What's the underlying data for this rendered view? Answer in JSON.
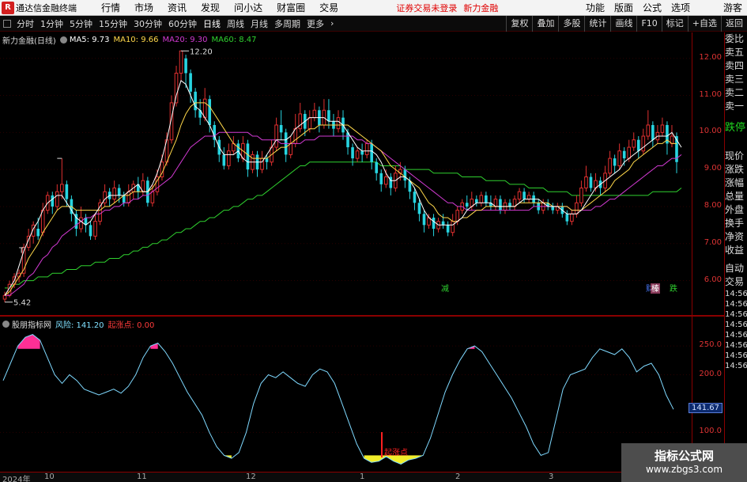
{
  "app": {
    "logo": "R",
    "title": "通达信金融终端"
  },
  "menu": [
    "行情",
    "市场",
    "资讯",
    "发现",
    "问小达",
    "财富圈",
    "交易"
  ],
  "menu_status": {
    "trade_login": "证券交易未登录",
    "broker": "新力金融"
  },
  "menu_right": [
    "功能",
    "版面",
    "公式",
    "选项",
    "游客"
  ],
  "toolbar": {
    "periods": [
      "分时",
      "1分钟",
      "5分钟",
      "15分钟",
      "30分钟",
      "60分钟",
      "日线",
      "周线",
      "月线",
      "多周期",
      "更多"
    ],
    "active_period": "日线",
    "right_buttons": [
      "复权",
      "叠加",
      "多股",
      "统计",
      "画线",
      "F10",
      "标记",
      "+自选",
      "返回"
    ]
  },
  "main_legend": {
    "stock": "新力金融(日线)",
    "ma5": "MA5: 9.73",
    "ma10": "MA10: 9.66",
    "ma20": "MA20: 9.30",
    "ma60": "MA60: 8.47",
    "colors": {
      "ma5": "#ffffff",
      "ma10": "#ffd84a",
      "ma20": "#d23ad2",
      "ma60": "#2fd12f",
      "up": "#e03030",
      "down": "#27d4e0"
    }
  },
  "price_axis": [
    "12.00",
    "11.00",
    "10.00",
    "9.00",
    "8.00",
    "7.00",
    "6.00"
  ],
  "annotations": {
    "high": "12.20",
    "low": "5.42",
    "t_marker": "T",
    "jian": "减",
    "cha": "财",
    "rong": "榛",
    "die": "跌"
  },
  "indicator_legend": {
    "name": "股朋指标网",
    "risk": "风险: 141.20",
    "start": "起涨点: 0.00",
    "start_marker": "起涨点"
  },
  "indicator_axis": [
    "250.0",
    "200.0",
    "141.67",
    "100.0"
  ],
  "dates": [
    "2024年",
    "10",
    "11",
    "12",
    "1",
    "2",
    "3"
  ],
  "right_panel": {
    "items_top": [
      "委比",
      "卖五",
      "卖四",
      "卖三",
      "卖二",
      "卖一"
    ],
    "status": "跌停",
    "items_mid": [
      "现价",
      "涨跌",
      "涨幅",
      "总量",
      "外盘",
      "换手",
      "净资",
      "收益"
    ],
    "items_bottom": [
      "自动",
      "交易"
    ],
    "times": [
      "14:56",
      "14:56",
      "14:56",
      "14:56",
      "14:56",
      "14:56",
      "14:56",
      "14:56"
    ]
  },
  "watermark": {
    "title": "指标公式网",
    "url": "www.zbgs3.com"
  },
  "chart_data": {
    "type": "candlestick",
    "ylim": [
      5.2,
      12.4
    ],
    "candles": [
      [
        5.5,
        5.6,
        5.42,
        5.7
      ],
      [
        5.6,
        5.9,
        5.55,
        6.0
      ],
      [
        5.9,
        6.1,
        5.8,
        6.2
      ],
      [
        6.1,
        6.2,
        5.95,
        6.3
      ],
      [
        6.2,
        6.9,
        6.1,
        7.0
      ],
      [
        6.9,
        7.2,
        6.8,
        7.4
      ],
      [
        7.2,
        7.5,
        7.0,
        7.6
      ],
      [
        7.4,
        7.2,
        7.1,
        7.7
      ],
      [
        7.3,
        7.9,
        7.2,
        8.1
      ],
      [
        7.9,
        8.3,
        7.8,
        8.4
      ],
      [
        8.3,
        8.0,
        7.8,
        8.4
      ],
      [
        8.0,
        8.4,
        7.9,
        8.6
      ],
      [
        8.4,
        8.6,
        8.2,
        9.3
      ],
      [
        8.6,
        8.2,
        8.0,
        8.7
      ],
      [
        8.2,
        7.8,
        7.6,
        8.3
      ],
      [
        7.8,
        7.4,
        7.2,
        7.9
      ],
      [
        7.4,
        7.7,
        7.3,
        8.0
      ],
      [
        7.7,
        7.5,
        7.3,
        7.8
      ],
      [
        7.5,
        7.2,
        7.1,
        7.6
      ],
      [
        7.2,
        7.6,
        7.1,
        7.8
      ],
      [
        7.6,
        8.1,
        7.5,
        8.2
      ],
      [
        8.1,
        8.4,
        8.0,
        8.6
      ],
      [
        8.4,
        8.2,
        8.0,
        8.5
      ],
      [
        8.2,
        8.5,
        8.1,
        8.7
      ],
      [
        8.5,
        8.3,
        8.1,
        8.6
      ],
      [
        8.3,
        8.1,
        8.0,
        8.4
      ],
      [
        8.1,
        8.4,
        8.0,
        8.6
      ],
      [
        8.4,
        8.6,
        8.2,
        8.7
      ],
      [
        8.6,
        8.4,
        8.2,
        8.8
      ],
      [
        8.4,
        8.7,
        8.3,
        8.9
      ],
      [
        8.7,
        8.1,
        8.0,
        8.8
      ],
      [
        8.1,
        8.4,
        8.0,
        8.6
      ],
      [
        8.4,
        8.8,
        8.3,
        9.0
      ],
      [
        8.8,
        9.2,
        8.7,
        9.4
      ],
      [
        9.2,
        9.8,
        9.1,
        10.0
      ],
      [
        9.8,
        10.8,
        9.7,
        11.0
      ],
      [
        10.8,
        11.6,
        10.7,
        11.8
      ],
      [
        11.6,
        12.2,
        11.4,
        12.2
      ],
      [
        12.0,
        11.6,
        11.2,
        12.1
      ],
      [
        11.6,
        11.1,
        10.8,
        11.7
      ],
      [
        11.1,
        10.6,
        10.4,
        11.2
      ],
      [
        10.6,
        10.4,
        10.2,
        10.9
      ],
      [
        10.4,
        10.9,
        10.3,
        11.2
      ],
      [
        10.9,
        10.2,
        10.0,
        11.0
      ],
      [
        10.2,
        9.8,
        9.6,
        10.3
      ],
      [
        9.8,
        9.4,
        9.2,
        9.9
      ],
      [
        9.4,
        9.1,
        9.0,
        9.6
      ],
      [
        9.1,
        9.5,
        9.0,
        9.7
      ],
      [
        9.5,
        9.7,
        9.4,
        9.9
      ],
      [
        9.7,
        9.3,
        9.2,
        9.8
      ],
      [
        9.3,
        9.7,
        9.2,
        9.9
      ],
      [
        9.7,
        9.0,
        8.8,
        9.8
      ],
      [
        9.0,
        9.4,
        8.9,
        9.5
      ],
      [
        9.4,
        9.0,
        8.8,
        9.5
      ],
      [
        9.0,
        9.3,
        8.9,
        9.5
      ],
      [
        9.3,
        9.2,
        9.0,
        9.4
      ],
      [
        9.2,
        9.6,
        9.1,
        9.8
      ],
      [
        9.6,
        10.2,
        9.5,
        10.4
      ],
      [
        10.2,
        10.0,
        9.8,
        10.6
      ],
      [
        10.0,
        9.4,
        9.2,
        10.1
      ],
      [
        9.4,
        9.7,
        9.3,
        9.9
      ],
      [
        9.7,
        10.1,
        9.6,
        10.5
      ],
      [
        10.1,
        10.5,
        10.0,
        10.8
      ],
      [
        10.5,
        10.1,
        9.9,
        10.6
      ],
      [
        10.1,
        10.4,
        10.0,
        10.6
      ],
      [
        10.4,
        10.6,
        10.3,
        10.8
      ],
      [
        10.6,
        10.2,
        10.0,
        10.7
      ],
      [
        10.2,
        10.6,
        10.1,
        10.9
      ],
      [
        10.6,
        10.3,
        10.1,
        10.9
      ],
      [
        10.3,
        10.1,
        9.9,
        10.5
      ],
      [
        10.1,
        10.4,
        10.0,
        10.6
      ],
      [
        10.4,
        10.0,
        9.8,
        10.6
      ],
      [
        10.0,
        9.6,
        9.4,
        10.1
      ],
      [
        9.6,
        9.3,
        9.1,
        9.7
      ],
      [
        9.3,
        9.5,
        9.2,
        9.6
      ],
      [
        9.5,
        9.4,
        9.2,
        9.7
      ],
      [
        9.4,
        9.7,
        9.3,
        9.8
      ],
      [
        9.7,
        9.2,
        9.0,
        9.8
      ],
      [
        9.2,
        8.9,
        8.7,
        9.3
      ],
      [
        8.9,
        8.6,
        8.4,
        9.0
      ],
      [
        8.6,
        8.8,
        8.5,
        9.0
      ],
      [
        8.8,
        8.5,
        8.3,
        8.9
      ],
      [
        8.5,
        8.9,
        8.4,
        9.1
      ],
      [
        8.9,
        9.0,
        8.7,
        9.2
      ],
      [
        9.0,
        8.7,
        8.5,
        9.1
      ],
      [
        8.7,
        8.4,
        8.2,
        8.8
      ],
      [
        8.4,
        8.1,
        7.9,
        8.5
      ],
      [
        8.1,
        7.8,
        7.6,
        8.2
      ],
      [
        7.8,
        7.5,
        7.3,
        7.9
      ],
      [
        7.5,
        7.7,
        7.4,
        7.8
      ],
      [
        7.7,
        7.4,
        7.2,
        7.8
      ],
      [
        7.4,
        7.6,
        7.3,
        7.7
      ],
      [
        7.6,
        7.5,
        7.4,
        7.8
      ],
      [
        7.5,
        7.3,
        7.2,
        7.6
      ],
      [
        7.3,
        7.6,
        7.2,
        7.8
      ],
      [
        7.6,
        7.9,
        7.5,
        8.0
      ],
      [
        7.9,
        8.1,
        7.8,
        8.2
      ],
      [
        8.1,
        8.0,
        7.9,
        8.3
      ],
      [
        8.0,
        8.2,
        7.9,
        8.4
      ],
      [
        8.2,
        8.1,
        8.0,
        8.3
      ],
      [
        8.1,
        8.3,
        8.0,
        8.4
      ],
      [
        8.3,
        8.1,
        8.0,
        8.4
      ],
      [
        8.1,
        8.0,
        7.9,
        8.3
      ],
      [
        8.0,
        8.2,
        7.9,
        8.3
      ],
      [
        8.2,
        7.9,
        7.8,
        8.3
      ],
      [
        7.9,
        8.1,
        7.8,
        8.2
      ],
      [
        8.1,
        8.0,
        7.9,
        8.2
      ],
      [
        8.0,
        8.2,
        7.9,
        8.3
      ],
      [
        8.2,
        8.4,
        8.1,
        8.5
      ],
      [
        8.4,
        8.2,
        8.1,
        8.5
      ],
      [
        8.2,
        8.3,
        8.1,
        8.4
      ],
      [
        8.3,
        8.1,
        8.0,
        8.4
      ],
      [
        8.1,
        7.9,
        7.8,
        8.2
      ],
      [
        7.9,
        8.1,
        7.8,
        8.2
      ],
      [
        8.1,
        8.0,
        7.9,
        8.2
      ],
      [
        8.0,
        7.9,
        7.8,
        8.1
      ],
      [
        7.9,
        8.0,
        7.8,
        8.1
      ],
      [
        8.0,
        7.8,
        7.7,
        8.1
      ],
      [
        7.8,
        7.6,
        7.5,
        7.9
      ],
      [
        7.6,
        7.8,
        7.5,
        7.9
      ],
      [
        7.8,
        8.1,
        7.7,
        8.3
      ],
      [
        8.1,
        8.5,
        8.0,
        8.7
      ],
      [
        8.5,
        8.8,
        8.4,
        9.1
      ],
      [
        8.8,
        8.5,
        8.4,
        8.9
      ],
      [
        8.5,
        8.7,
        8.4,
        8.9
      ],
      [
        8.7,
        8.5,
        8.3,
        8.8
      ],
      [
        8.5,
        8.9,
        8.4,
        9.1
      ],
      [
        8.9,
        9.3,
        8.8,
        9.5
      ],
      [
        9.3,
        9.1,
        8.9,
        9.4
      ],
      [
        9.1,
        9.5,
        9.0,
        9.7
      ],
      [
        9.5,
        9.3,
        9.1,
        9.6
      ],
      [
        9.3,
        9.6,
        9.2,
        9.8
      ],
      [
        9.6,
        9.8,
        9.5,
        10.0
      ],
      [
        9.8,
        9.5,
        9.3,
        9.9
      ],
      [
        9.5,
        9.9,
        9.4,
        10.1
      ],
      [
        9.9,
        10.2,
        9.8,
        10.6
      ],
      [
        10.2,
        9.8,
        9.6,
        10.3
      ],
      [
        9.8,
        10.0,
        9.7,
        10.2
      ],
      [
        10.0,
        10.2,
        9.9,
        10.4
      ],
      [
        10.2,
        9.7,
        9.4,
        10.3
      ],
      [
        9.7,
        9.9,
        9.6,
        10.2
      ],
      [
        9.9,
        9.2,
        8.9,
        10.0
      ]
    ],
    "ma5": [
      5.6,
      5.8,
      6.0,
      6.4,
      6.8,
      7.1,
      7.4,
      7.6,
      7.9,
      8.1,
      8.2,
      8.3,
      8.3,
      8.1,
      7.9,
      7.7,
      7.6,
      7.5,
      7.6,
      7.8,
      8.0,
      8.2,
      8.3,
      8.3,
      8.3,
      8.3,
      8.4,
      8.5,
      8.6,
      8.4,
      8.4,
      8.6,
      8.9,
      9.3,
      9.8,
      10.4,
      11.0,
      11.4,
      11.3,
      11.0,
      10.7,
      10.6,
      10.4,
      10.2,
      9.9,
      9.6,
      9.4,
      9.4,
      9.4,
      9.5,
      9.3,
      9.2,
      9.2,
      9.2,
      9.2,
      9.4,
      9.6,
      9.8,
      9.8,
      9.8,
      9.9,
      10.1,
      10.2,
      10.3,
      10.4,
      10.4,
      10.4,
      10.4,
      10.3,
      10.3,
      10.3,
      10.2,
      10.0,
      9.8,
      9.6,
      9.5,
      9.5,
      9.5,
      9.4,
      9.2,
      8.9,
      8.7,
      8.7,
      8.8,
      8.8,
      8.7,
      8.5,
      8.2,
      7.9,
      7.7,
      7.6,
      7.5,
      7.5,
      7.5,
      7.5,
      7.6,
      7.7,
      7.9,
      8.0,
      8.1,
      8.1,
      8.1,
      8.1,
      8.0,
      8.0,
      8.0,
      8.0,
      8.0,
      8.1,
      8.2,
      8.2,
      8.2,
      8.2,
      8.1,
      8.0,
      8.0,
      8.0,
      7.9,
      7.8,
      7.8,
      7.8,
      7.9,
      8.1,
      8.3,
      8.5,
      8.6,
      8.7,
      8.8,
      8.9,
      9.0,
      9.2,
      9.3,
      9.4,
      9.5,
      9.6,
      9.7,
      9.8,
      9.9,
      9.9,
      9.9,
      10.0,
      9.8,
      9.6
    ],
    "ma10": [
      5.6,
      5.7,
      5.9,
      6.1,
      6.3,
      6.6,
      6.8,
      7.0,
      7.3,
      7.5,
      7.7,
      7.9,
      8.0,
      8.0,
      8.0,
      7.9,
      7.9,
      7.9,
      7.9,
      7.9,
      7.9,
      8.0,
      8.0,
      8.1,
      8.2,
      8.3,
      8.3,
      8.4,
      8.4,
      8.4,
      8.4,
      8.5,
      8.7,
      8.9,
      9.2,
      9.5,
      9.8,
      10.2,
      10.5,
      10.7,
      10.8,
      10.8,
      10.8,
      10.7,
      10.5,
      10.3,
      10.1,
      9.9,
      9.7,
      9.6,
      9.5,
      9.4,
      9.3,
      9.3,
      9.3,
      9.3,
      9.4,
      9.5,
      9.6,
      9.6,
      9.7,
      9.8,
      9.9,
      10.0,
      10.1,
      10.1,
      10.2,
      10.2,
      10.2,
      10.2,
      10.2,
      10.2,
      10.2,
      10.1,
      10.0,
      9.9,
      9.8,
      9.7,
      9.6,
      9.5,
      9.3,
      9.1,
      9.0,
      8.9,
      8.8,
      8.7,
      8.6,
      8.5,
      8.3,
      8.1,
      8.0,
      7.8,
      7.7,
      7.7,
      7.6,
      7.6,
      7.7,
      7.7,
      7.8,
      7.9,
      7.9,
      8.0,
      8.0,
      8.0,
      8.0,
      8.0,
      8.0,
      8.0,
      8.1,
      8.1,
      8.1,
      8.1,
      8.1,
      8.1,
      8.1,
      8.0,
      8.0,
      8.0,
      8.0,
      7.9,
      7.9,
      7.9,
      8.0,
      8.1,
      8.2,
      8.3,
      8.4,
      8.5,
      8.7,
      8.8,
      8.9,
      9.0,
      9.2,
      9.3,
      9.4,
      9.5,
      9.6,
      9.7,
      9.7,
      9.8,
      9.7,
      9.7
    ],
    "ma20": [
      5.6,
      5.6,
      5.7,
      5.8,
      5.9,
      6.1,
      6.2,
      6.4,
      6.6,
      6.7,
      6.9,
      7.0,
      7.2,
      7.3,
      7.4,
      7.5,
      7.6,
      7.7,
      7.7,
      7.8,
      7.8,
      7.9,
      7.9,
      8.0,
      8.0,
      8.1,
      8.1,
      8.2,
      8.2,
      8.3,
      8.3,
      8.4,
      8.5,
      8.6,
      8.7,
      8.8,
      9.0,
      9.2,
      9.4,
      9.6,
      9.7,
      9.8,
      9.9,
      9.9,
      9.9,
      10.0,
      10.0,
      10.0,
      10.0,
      10.0,
      10.0,
      10.0,
      9.9,
      9.9,
      9.8,
      9.8,
      9.8,
      9.8,
      9.7,
      9.7,
      9.7,
      9.7,
      9.7,
      9.8,
      9.8,
      9.8,
      9.9,
      9.9,
      9.9,
      9.9,
      9.9,
      9.9,
      9.9,
      9.9,
      9.8,
      9.8,
      9.7,
      9.7,
      9.6,
      9.5,
      9.4,
      9.3,
      9.2,
      9.1,
      9.0,
      8.9,
      8.8,
      8.7,
      8.6,
      8.5,
      8.4,
      8.3,
      8.2,
      8.1,
      8.1,
      8.0,
      8.0,
      7.9,
      7.9,
      7.9,
      7.9,
      7.9,
      7.9,
      7.9,
      7.9,
      7.9,
      7.9,
      7.9,
      7.9,
      7.9,
      7.9,
      8.0,
      8.0,
      8.0,
      8.0,
      8.0,
      8.0,
      8.0,
      8.0,
      7.9,
      7.9,
      7.9,
      7.9,
      7.9,
      8.0,
      8.0,
      8.1,
      8.2,
      8.2,
      8.3,
      8.4,
      8.5,
      8.6,
      8.7,
      8.8,
      8.9,
      9.0,
      9.1,
      9.1,
      9.2,
      9.3,
      9.3,
      9.4
    ],
    "ma60": [
      5.8,
      5.8,
      5.9,
      5.9,
      6.0,
      6.0,
      6.0,
      6.1,
      6.1,
      6.1,
      6.2,
      6.2,
      6.2,
      6.3,
      6.3,
      6.3,
      6.4,
      6.4,
      6.4,
      6.5,
      6.5,
      6.5,
      6.6,
      6.6,
      6.6,
      6.7,
      6.7,
      6.8,
      6.8,
      6.9,
      6.9,
      7.0,
      7.0,
      7.1,
      7.1,
      7.2,
      7.3,
      7.3,
      7.4,
      7.4,
      7.5,
      7.6,
      7.6,
      7.7,
      7.7,
      7.8,
      7.9,
      7.9,
      8.0,
      8.0,
      8.1,
      8.2,
      8.2,
      8.3,
      8.3,
      8.4,
      8.5,
      8.6,
      8.7,
      8.8,
      8.9,
      9.0,
      9.1,
      9.1,
      9.2,
      9.2,
      9.2,
      9.2,
      9.2,
      9.2,
      9.2,
      9.2,
      9.2,
      9.2,
      9.2,
      9.2,
      9.2,
      9.2,
      9.2,
      9.1,
      9.1,
      9.1,
      9.1,
      9.1,
      9.0,
      9.0,
      9.0,
      9.0,
      9.0,
      9.0,
      8.9,
      8.9,
      8.9,
      8.9,
      8.9,
      8.9,
      8.8,
      8.8,
      8.8,
      8.8,
      8.8,
      8.7,
      8.7,
      8.7,
      8.7,
      8.7,
      8.6,
      8.6,
      8.6,
      8.6,
      8.5,
      8.5,
      8.5,
      8.5,
      8.4,
      8.4,
      8.4,
      8.4,
      8.4,
      8.3,
      8.3,
      8.3,
      8.3,
      8.3,
      8.3,
      8.3,
      8.3,
      8.3,
      8.3,
      8.3,
      8.3,
      8.3,
      8.3,
      8.3,
      8.3,
      8.3,
      8.4,
      8.4,
      8.4,
      8.4,
      8.4,
      8.4,
      8.5
    ],
    "indicator": {
      "ylim": [
        40,
        290
      ],
      "values": [
        190,
        220,
        250,
        265,
        270,
        260,
        230,
        200,
        185,
        200,
        190,
        175,
        170,
        165,
        170,
        175,
        168,
        180,
        200,
        230,
        250,
        255,
        240,
        220,
        195,
        170,
        150,
        130,
        100,
        75,
        60,
        55,
        65,
        100,
        150,
        185,
        200,
        195,
        205,
        195,
        185,
        180,
        200,
        210,
        205,
        185,
        150,
        115,
        80,
        55,
        48,
        50,
        58,
        50,
        45,
        52,
        55,
        60,
        90,
        130,
        170,
        200,
        225,
        245,
        250,
        240,
        220,
        200,
        180,
        160,
        135,
        110,
        80,
        60,
        65,
        120,
        175,
        200,
        205,
        210,
        230,
        245,
        240,
        235,
        245,
        230,
        205,
        215,
        220,
        200,
        165,
        140
      ]
    }
  }
}
